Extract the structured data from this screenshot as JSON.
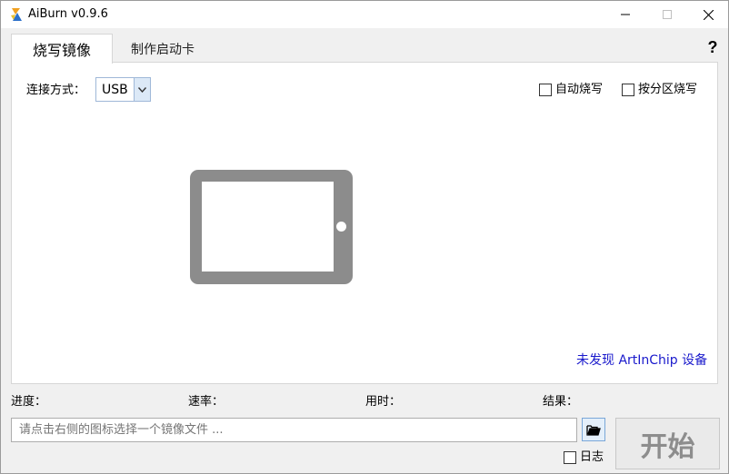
{
  "titlebar": {
    "title": "AiBurn v0.9.6",
    "minimize_icon": "minimize-icon",
    "maximize_icon": "maximize-icon",
    "close_icon": "close-icon"
  },
  "tabs": [
    {
      "label": "烧写镜像",
      "active": true
    },
    {
      "label": "制作启动卡",
      "active": false
    }
  ],
  "help": {
    "label": "?"
  },
  "connection": {
    "label": "连接方式：",
    "selected": "USB"
  },
  "options": {
    "auto_burn": {
      "label": "自动烧写",
      "checked": false
    },
    "partition_burn": {
      "label": "按分区烧写",
      "checked": false
    }
  },
  "device": {
    "icon": "tablet-icon",
    "status": "未发现 ArtInChip 设备",
    "status_color": "#1a1acc"
  },
  "stats": {
    "progress_label": "进度：",
    "speed_label": "速率：",
    "time_label": "用时：",
    "result_label": "结果："
  },
  "file": {
    "placeholder": "请点击右侧的图标选择一个镜像文件 ..."
  },
  "log": {
    "label": "日志",
    "checked": false
  },
  "start_button": {
    "label": "开始"
  }
}
